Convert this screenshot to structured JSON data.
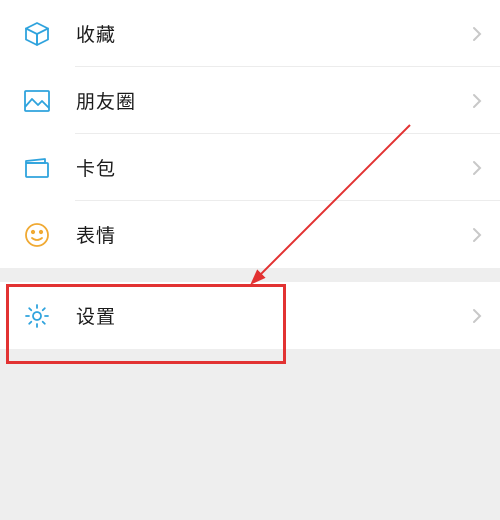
{
  "menu": {
    "group1": [
      {
        "id": "favorites",
        "label": "收藏"
      },
      {
        "id": "moments",
        "label": "朋友圈"
      },
      {
        "id": "cards",
        "label": "卡包"
      },
      {
        "id": "stickers",
        "label": "表情"
      }
    ],
    "group2": [
      {
        "id": "settings",
        "label": "设置"
      }
    ]
  }
}
